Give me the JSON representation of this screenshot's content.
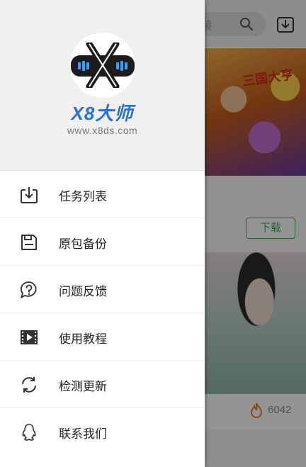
{
  "background": {
    "search_hint": "镜",
    "download_button_label": "下载",
    "banner_title": "三国大亨",
    "play_count": "6042"
  },
  "drawer": {
    "brand_name": "X8大师",
    "brand_url": "www.x8ds.com",
    "items": [
      {
        "label": "任务列表",
        "icon": "download-tray-icon"
      },
      {
        "label": "原包备份",
        "icon": "floppy-save-icon"
      },
      {
        "label": "问题反馈",
        "icon": "question-chat-icon"
      },
      {
        "label": "使用教程",
        "icon": "video-film-icon"
      },
      {
        "label": "检测更新",
        "icon": "refresh-icon"
      },
      {
        "label": "联系我们",
        "icon": "qq-penguin-icon"
      }
    ]
  },
  "colors": {
    "brand_blue": "#2a72d2",
    "download_green": "#3fae4d",
    "fire_orange": "#f07a2a",
    "icon_gray": "#333333"
  }
}
